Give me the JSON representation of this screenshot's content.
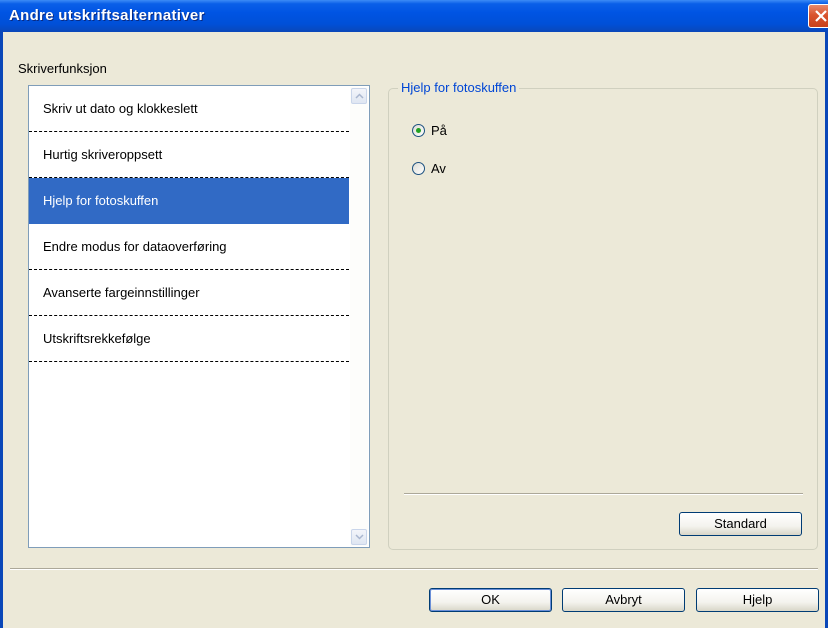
{
  "window": {
    "title": "Andre utskriftsalternativer"
  },
  "function_list": {
    "label": "Skriverfunksjon",
    "items": [
      {
        "label": "Skriv ut dato og klokkeslett",
        "selected": false
      },
      {
        "label": "Hurtig skriveroppsett",
        "selected": false
      },
      {
        "label": "Hjelp for fotoskuffen",
        "selected": true
      },
      {
        "label": "Endre modus for dataoverføring",
        "selected": false
      },
      {
        "label": "Avanserte fargeinnstillinger",
        "selected": false
      },
      {
        "label": "Utskriftsrekkefølge",
        "selected": false
      }
    ]
  },
  "settings": {
    "legend": "Hjelp for fotoskuffen",
    "options": [
      {
        "label": "På",
        "checked": true
      },
      {
        "label": "Av",
        "checked": false
      }
    ],
    "standard_label": "Standard"
  },
  "footer": {
    "ok_label": "OK",
    "cancel_label": "Avbryt",
    "help_label": "Hjelp"
  },
  "colors": {
    "title_bar": "#0054e3",
    "selection": "#316ac5",
    "legend_text": "#0046d5",
    "radio_dot": "#21a121"
  }
}
